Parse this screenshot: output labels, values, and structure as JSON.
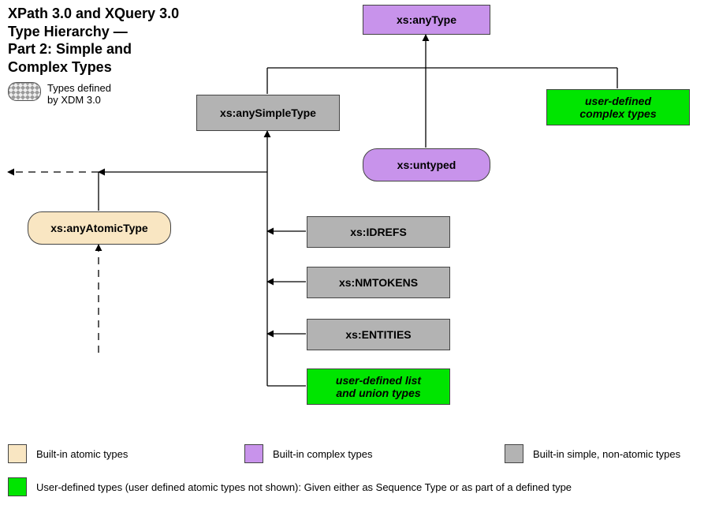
{
  "title_lines": [
    "XPath 3.0 and XQuery 3.0",
    "Type Hierarchy —",
    "Part 2: Simple and",
    "Complex Types"
  ],
  "xdm_legend": "Types defined\nby XDM 3.0",
  "nodes": {
    "anyType": "xs:anyType",
    "anySimpleType": "xs:anySimpleType",
    "userComplex": "user-defined\ncomplex types",
    "untyped": "xs:untyped",
    "anyAtomicType": "xs:anyAtomicType",
    "idrefs": "xs:IDREFS",
    "nmtokens": "xs:NMTOKENS",
    "entities": "xs:ENTITIES",
    "userListUnion": "user-defined list\nand union types"
  },
  "legend": {
    "atomic": "Built-in atomic types",
    "complex": "Built-in complex types",
    "simple": "Built-in simple, non-atomic types",
    "user": "User-defined types (user defined atomic types not shown):  Given either as Sequence Type or as part of a defined type"
  }
}
